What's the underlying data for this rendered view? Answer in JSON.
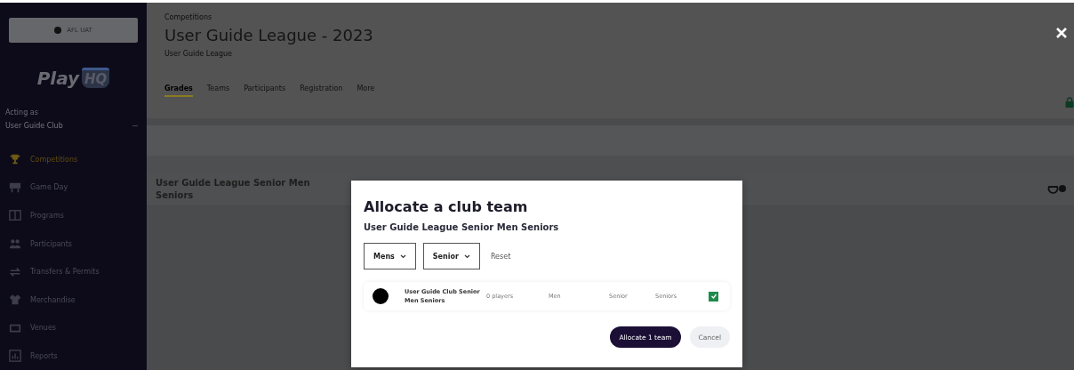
{
  "sidebar": {
    "account": "AFL UAT",
    "logo": {
      "text": "Play",
      "badge": "HQ"
    },
    "acting_as_label": "Acting as",
    "acting_as": "User Guide Club",
    "items": [
      {
        "label": "Competitions",
        "selected": true
      },
      {
        "label": "Game Day",
        "selected": false
      },
      {
        "label": "Programs",
        "selected": false
      },
      {
        "label": "Participants",
        "selected": false
      },
      {
        "label": "Transfers & Permits",
        "selected": false
      },
      {
        "label": "Merchandise",
        "selected": false
      },
      {
        "label": "Venues",
        "selected": false
      },
      {
        "label": "Reports",
        "selected": false
      }
    ]
  },
  "header": {
    "breadcrumb": "Competitions",
    "title": "User Guide League - 2023",
    "subtitle": "User Guide League"
  },
  "tabs": [
    {
      "label": "Grades",
      "selected": true
    },
    {
      "label": "Teams",
      "selected": false
    },
    {
      "label": "Participants",
      "selected": false
    },
    {
      "label": "Registration",
      "selected": false
    },
    {
      "label": "More",
      "selected": false
    }
  ],
  "grade_row": {
    "name": "User Guide League Senior Men Seniors"
  },
  "modal": {
    "title": "Allocate a club team",
    "subtitle": "User Guide League Senior Men Seniors",
    "filters": [
      {
        "value": "Mens"
      },
      {
        "value": "Senior"
      }
    ],
    "reset": "Reset",
    "teams": [
      {
        "name": "User Guide Club Senior Men Seniors",
        "players": "0 players",
        "gender": "Men",
        "age": "Senior",
        "grade": "Seniors",
        "checked": true
      }
    ],
    "buttons": [
      {
        "label": "Allocate 1 team",
        "kind": "primary"
      },
      {
        "label": "Cancel",
        "kind": "secondary"
      }
    ]
  }
}
